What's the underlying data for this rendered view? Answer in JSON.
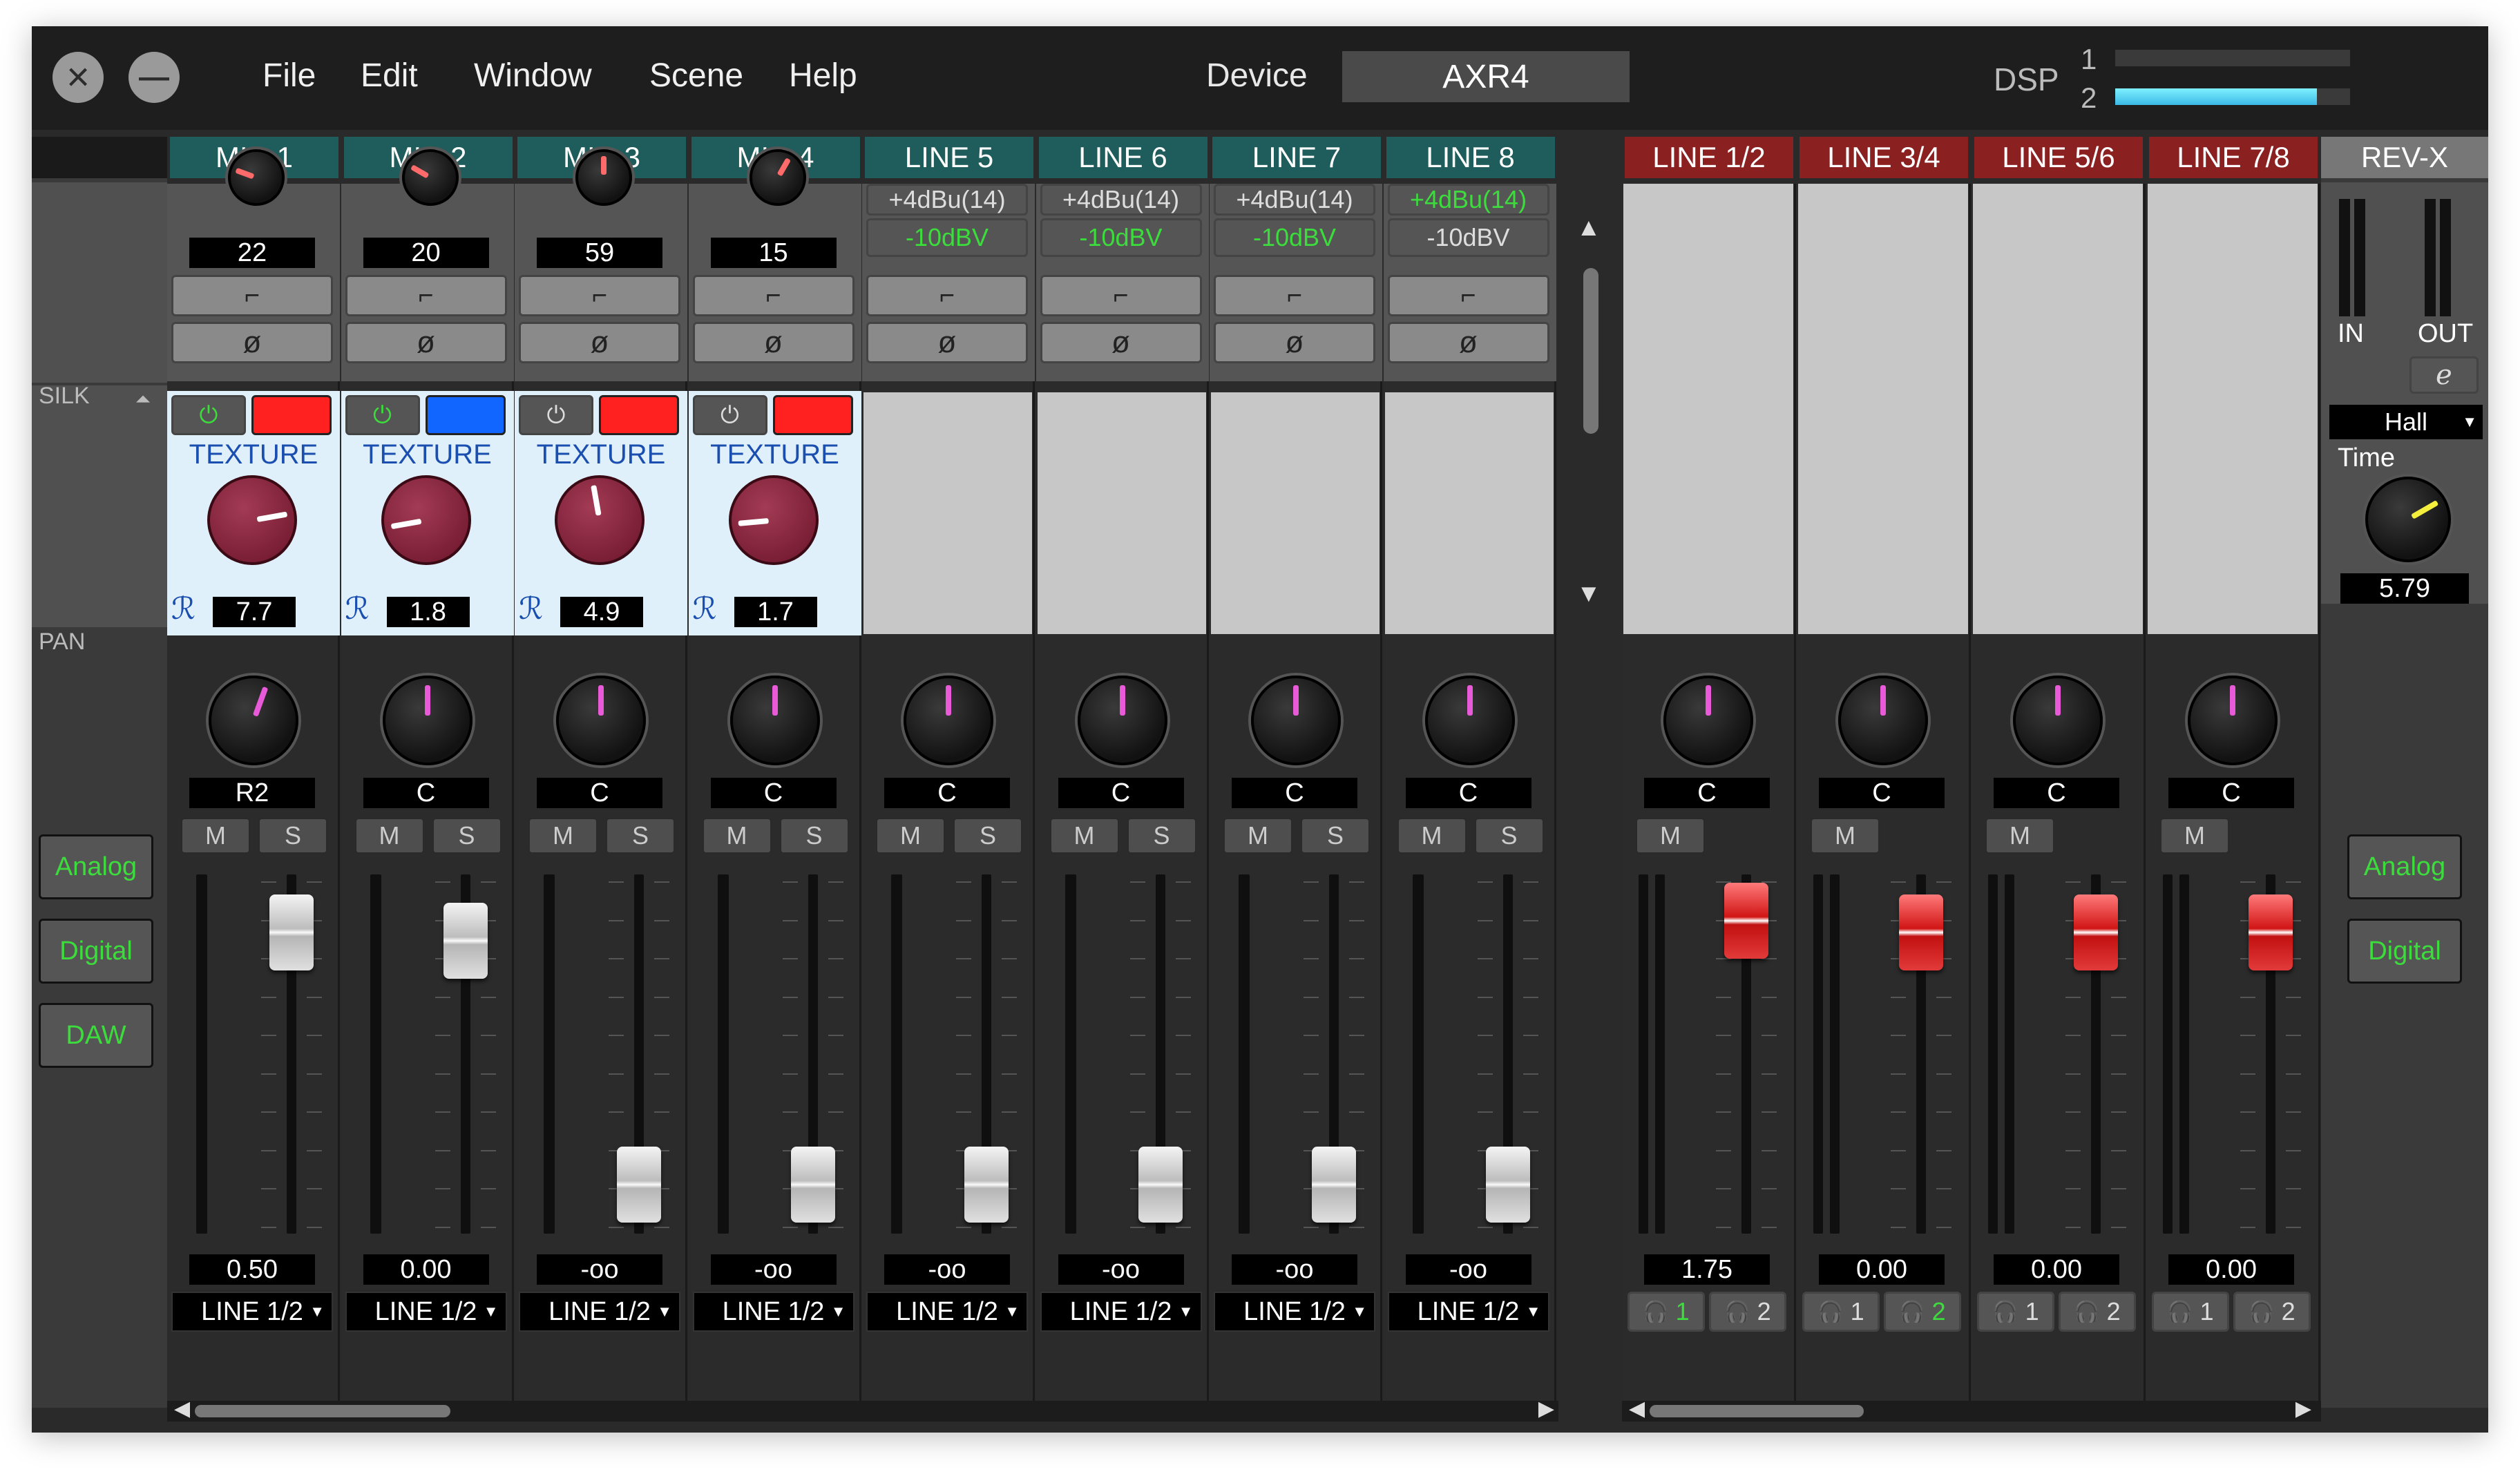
{
  "window": {
    "menus": [
      "File",
      "Edit",
      "Window",
      "Scene",
      "Help"
    ],
    "close_glyph": "×",
    "minimize_glyph": "—"
  },
  "device": {
    "label": "Device",
    "name": "AXR4"
  },
  "dsp": {
    "label": "DSP",
    "meters": [
      {
        "num": "1",
        "level": 0
      },
      {
        "num": "2",
        "level": 0.86
      }
    ]
  },
  "section_labels": {
    "silk": "SILK",
    "pan": "PAN"
  },
  "left_buttons": [
    "Analog",
    "Digital",
    "DAW"
  ],
  "right_buttons": [
    "Analog",
    "Digital"
  ],
  "input_channels": [
    {
      "name": "MIC 1",
      "gain": "22",
      "pan": "R2",
      "level": "0.50",
      "route": "LINE 1/2",
      "silk": true,
      "silk_color": "red",
      "silk_power": "on",
      "texture_label": "TEXTURE",
      "texture": "7.7"
    },
    {
      "name": "MIC 2",
      "gain": "20",
      "pan": "C",
      "level": "0.00",
      "route": "LINE 1/2",
      "silk": true,
      "silk_color": "blue",
      "silk_power": "on",
      "texture_label": "TEXTURE",
      "texture": "1.8"
    },
    {
      "name": "MIC 3",
      "gain": "59",
      "pan": "C",
      "level": "-oo",
      "route": "LINE 1/2",
      "silk": true,
      "silk_color": "red",
      "silk_power": "off",
      "texture_label": "TEXTURE",
      "texture": "4.9"
    },
    {
      "name": "MIC 4",
      "gain": "15",
      "pan": "C",
      "level": "-oo",
      "route": "LINE 1/2",
      "silk": true,
      "silk_color": "red",
      "silk_power": "off",
      "texture_label": "TEXTURE",
      "texture": "1.7"
    },
    {
      "name": "LINE 5",
      "plus4": "+4dBu(14)",
      "minus10": "-10dBV",
      "minus10_active": true,
      "pan": "C",
      "level": "-oo",
      "route": "LINE 1/2",
      "silk": false
    },
    {
      "name": "LINE 6",
      "plus4": "+4dBu(14)",
      "minus10": "-10dBV",
      "minus10_active": true,
      "pan": "C",
      "level": "-oo",
      "route": "LINE 1/2",
      "silk": false
    },
    {
      "name": "LINE 7",
      "plus4": "+4dBu(14)",
      "minus10": "-10dBV",
      "minus10_active": true,
      "pan": "C",
      "level": "-oo",
      "route": "LINE 1/2",
      "silk": false
    },
    {
      "name": "LINE 8",
      "plus4": "+4dBu(14)",
      "minus10": "-10dBV",
      "minus10_active": false,
      "pan": "C",
      "level": "-oo",
      "route": "LINE 1/2",
      "silk": false
    }
  ],
  "output_channels": [
    {
      "name": "LINE 1/2",
      "pan": "C",
      "level": "1.75",
      "hp1": "1",
      "hp2": "2",
      "hp_active": "1"
    },
    {
      "name": "LINE 3/4",
      "pan": "C",
      "level": "0.00",
      "hp1": "1",
      "hp2": "2",
      "hp_active": "2"
    },
    {
      "name": "LINE 5/6",
      "pan": "C",
      "level": "0.00",
      "hp1": "1",
      "hp2": "2",
      "hp_active": ""
    },
    {
      "name": "LINE 7/8",
      "pan": "C",
      "level": "0.00",
      "hp1": "1",
      "hp2": "2",
      "hp_active": ""
    }
  ],
  "buttons": {
    "mute": "M",
    "solo": "S",
    "hpf": "⌐",
    "phase": "ø"
  },
  "revx": {
    "name": "REV-X",
    "in": "IN",
    "out": "OUT",
    "type": "Hall",
    "time_label": "Time",
    "time": "5.79"
  },
  "colors": {
    "input_header": "#1e5d5c",
    "output_header": "#8b2021",
    "silk_panel": "#dff0fb",
    "texture_knob": "#7a1f34",
    "active_green": "#3ddc3d"
  }
}
